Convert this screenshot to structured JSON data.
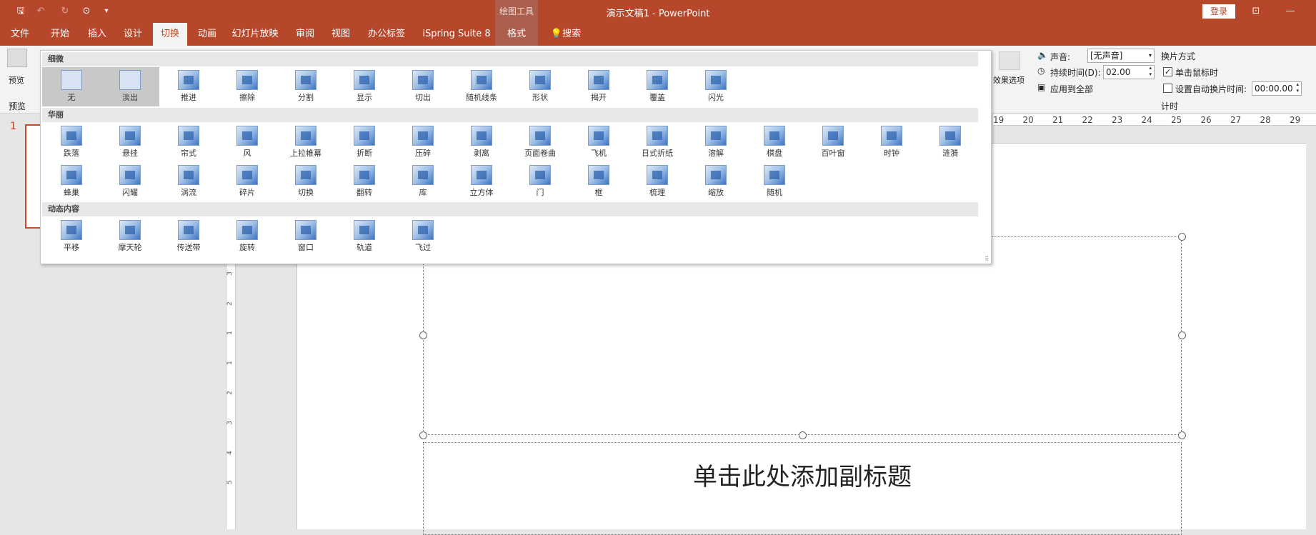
{
  "titlebar": {
    "title": "演示文稿1  -  PowerPoint",
    "context_label": "绘图工具",
    "login": "登录",
    "quick_access": {
      "save": "🖫",
      "undo": "↶",
      "redo": "↻",
      "touch": "⊙",
      "more": "▾"
    },
    "win": {
      "ribbon_display": "⊡",
      "minimize": "—"
    }
  },
  "tabs": [
    "文件",
    "开始",
    "插入",
    "设计",
    "切换",
    "动画",
    "幻灯片放映",
    "审阅",
    "视图",
    "办公标签",
    "iSpring Suite 8",
    "格式",
    "搜索"
  ],
  "ribbon": {
    "preview_label": "预览",
    "preview_group": "预览",
    "effect_options": "效果选项",
    "sound_label": "声音:",
    "sound_value": "[无声音]",
    "duration_label": "持续时间(D):",
    "duration_value": "02.00",
    "apply_all": "应用到全部",
    "advance_title": "换片方式",
    "on_click": "单击鼠标时",
    "after_time": "设置自动换片时间:",
    "after_value": "00:00.00",
    "timing_group": "计时"
  },
  "gallery": {
    "sections": [
      "细微",
      "华丽",
      "动态内容"
    ],
    "subtle": [
      "无",
      "淡出",
      "推进",
      "擦除",
      "分割",
      "显示",
      "切出",
      "随机线条",
      "形状",
      "揭开",
      "覆盖",
      "闪光"
    ],
    "exciting_row1": [
      "跌落",
      "悬挂",
      "帘式",
      "风",
      "上拉帷幕",
      "折断",
      "压碎",
      "剥离",
      "页面卷曲",
      "飞机",
      "日式折纸",
      "溶解",
      "棋盘",
      "百叶窗",
      "时钟",
      "涟漪"
    ],
    "exciting_row2": [
      "蜂巢",
      "闪耀",
      "涡流",
      "碎片",
      "切换",
      "翻转",
      "库",
      "立方体",
      "门",
      "框",
      "梳理",
      "缩放",
      "随机"
    ],
    "dynamic": [
      "平移",
      "摩天轮",
      "传送带",
      "旋转",
      "窗口",
      "轨道",
      "飞过"
    ]
  },
  "slides": {
    "number": "1"
  },
  "hruler": [
    "19",
    "20",
    "21",
    "22",
    "23",
    "24",
    "25",
    "26",
    "27",
    "28",
    "29"
  ],
  "vruler": [
    "3",
    "2",
    "1",
    "1",
    "2",
    "3",
    "4",
    "5"
  ],
  "slide": {
    "subtitle_placeholder": "单击此处添加副标题"
  }
}
